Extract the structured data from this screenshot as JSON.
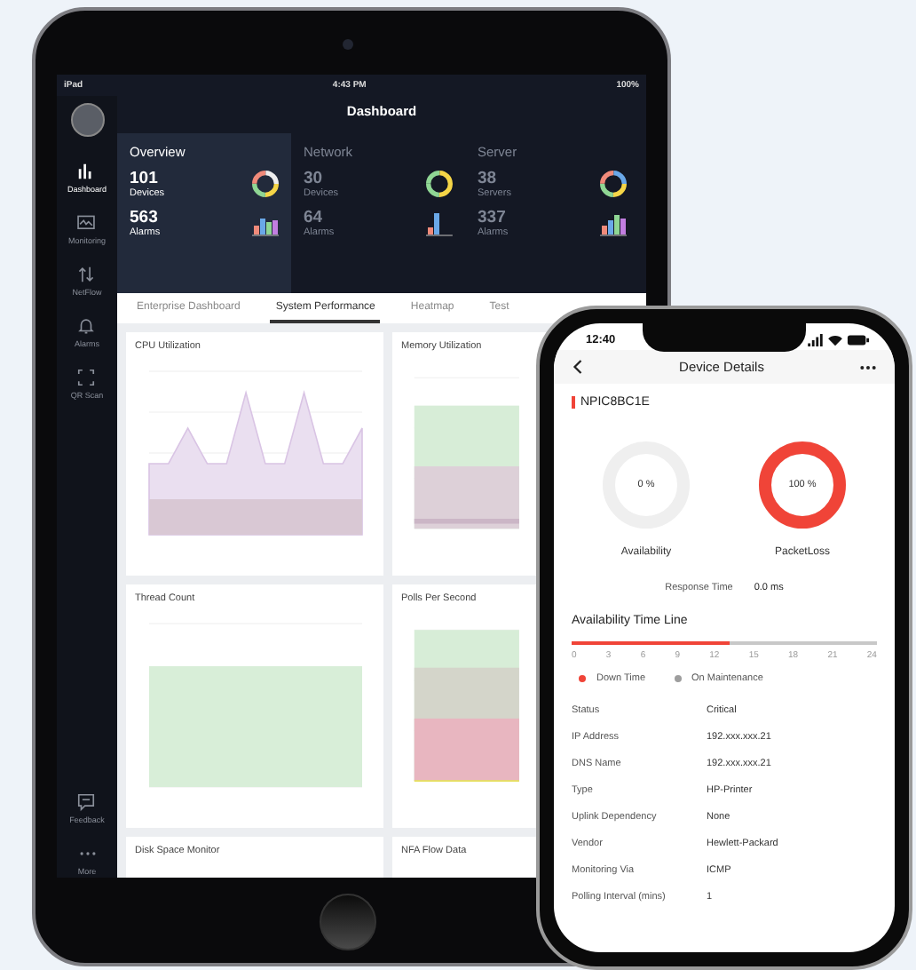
{
  "tablet": {
    "status_bar": {
      "carrier": "iPad",
      "time": "4:43 PM",
      "battery": "100%"
    },
    "sidebar": {
      "items": [
        {
          "label": "Dashboard",
          "selected": true
        },
        {
          "label": "Monitoring",
          "selected": false
        },
        {
          "label": "NetFlow",
          "selected": false
        },
        {
          "label": "Alarms",
          "selected": false
        },
        {
          "label": "QR Scan",
          "selected": false
        }
      ],
      "bottom_items": [
        {
          "label": "Feedback"
        },
        {
          "label": "More"
        }
      ]
    },
    "title": "Dashboard",
    "summary_tiles": [
      {
        "title": "Overview",
        "selected": true,
        "stats": [
          {
            "value": "101",
            "label": "Devices"
          },
          {
            "value": "563",
            "label": "Alarms"
          }
        ]
      },
      {
        "title": "Network",
        "selected": false,
        "stats": [
          {
            "value": "30",
            "label": "Devices"
          },
          {
            "value": "64",
            "label": "Alarms"
          }
        ]
      },
      {
        "title": "Server",
        "selected": false,
        "stats": [
          {
            "value": "38",
            "label": "Servers"
          },
          {
            "value": "337",
            "label": "Alarms"
          }
        ]
      }
    ],
    "tabs": [
      {
        "label": "Enterprise Dashboard",
        "selected": false
      },
      {
        "label": "System Performance",
        "selected": true
      },
      {
        "label": "Heatmap",
        "selected": false
      },
      {
        "label": "Test",
        "selected": false
      }
    ],
    "cards": [
      {
        "title": "CPU Utilization",
        "kind": "spikes"
      },
      {
        "title": "Memory Utilization",
        "kind": "bands"
      },
      {
        "title": "Thread Count",
        "kind": "flat"
      },
      {
        "title": "Polls Per Second",
        "kind": "stacked"
      },
      {
        "title": "Disk Space Monitor",
        "kind": "cut"
      },
      {
        "title": "NFA Flow Data",
        "kind": "cut"
      }
    ]
  },
  "phone": {
    "status_bar": {
      "time": "12:40"
    },
    "title": "Device Details",
    "device_name": "NPIC8BC1E",
    "gauges": [
      {
        "reading": "0 %",
        "label": "Availability",
        "level": 0
      },
      {
        "reading": "100 %",
        "label": "PacketLoss",
        "level": 1
      }
    ],
    "response_time": {
      "label": "Response Time",
      "value": "0.0 ms"
    },
    "timeline": {
      "title": "Availability Time Line",
      "level": 0.52,
      "ticks": [
        "0",
        "3",
        "6",
        "9",
        "12",
        "15",
        "18",
        "21",
        "24"
      ]
    },
    "legend": [
      {
        "label": "Down Time",
        "color": "#f04438"
      },
      {
        "label": "On Maintenance",
        "color": "#9e9e9e"
      }
    ],
    "details": [
      {
        "label": "Status",
        "value": "Critical"
      },
      {
        "label": "IP Address",
        "value": "192.xxx.xxx.21"
      },
      {
        "label": "DNS Name",
        "value": "192.xxx.xxx.21"
      },
      {
        "label": "Type",
        "value": "HP-Printer"
      },
      {
        "label": "Uplink Dependency",
        "value": "None"
      },
      {
        "label": "Vendor",
        "value": "Hewlett-Packard"
      },
      {
        "label": "Monitoring Via",
        "value": "ICMP"
      },
      {
        "label": "Polling Interval (mins)",
        "value": "1"
      }
    ]
  }
}
